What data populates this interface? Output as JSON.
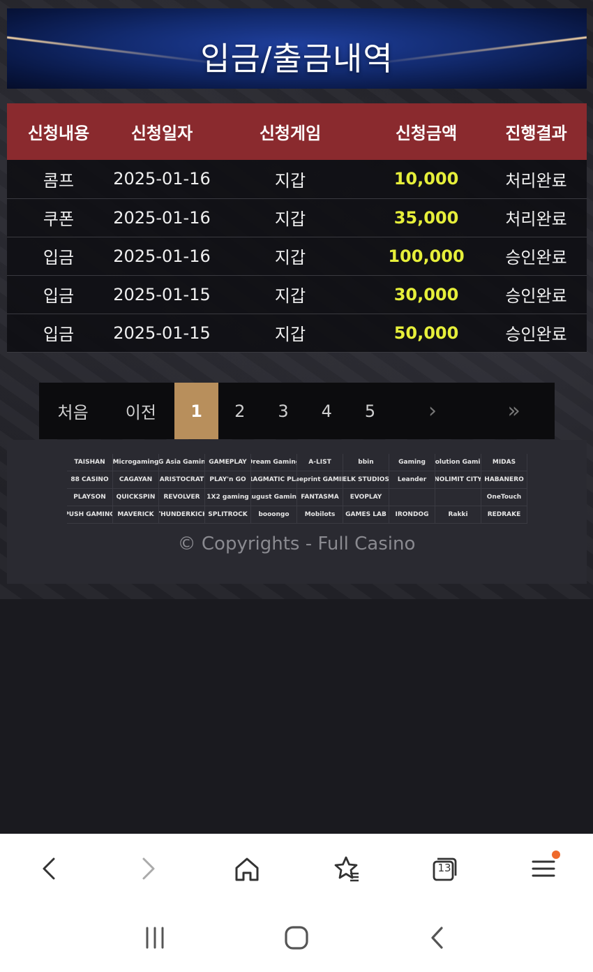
{
  "page": {
    "title": "입금/출금내역"
  },
  "table": {
    "headers": [
      "신청내용",
      "신청일자",
      "신청게임",
      "신청금액",
      "진행결과"
    ],
    "rows": [
      {
        "type": "콤프",
        "date": "2025-01-16",
        "game": "지갑",
        "amount": "10,000",
        "result": "처리완료"
      },
      {
        "type": "쿠폰",
        "date": "2025-01-16",
        "game": "지갑",
        "amount": "35,000",
        "result": "처리완료"
      },
      {
        "type": "입금",
        "date": "2025-01-16",
        "game": "지갑",
        "amount": "100,000",
        "result": "승인완료"
      },
      {
        "type": "입금",
        "date": "2025-01-15",
        "game": "지갑",
        "amount": "30,000",
        "result": "승인완료"
      },
      {
        "type": "입금",
        "date": "2025-01-15",
        "game": "지갑",
        "amount": "50,000",
        "result": "승인완료"
      }
    ],
    "colors": {
      "header_bg": "#8a2a2e",
      "amount": "#e6ef3a"
    }
  },
  "pagination": {
    "first": "처음",
    "prev": "이전",
    "pages": [
      "1",
      "2",
      "3",
      "4",
      "5"
    ],
    "active": "1",
    "next_icon": "chevron-right-icon",
    "last_icon": "double-chevron-right-icon",
    "active_color": "#b88f5c"
  },
  "footer": {
    "providers": [
      "TAISHAN",
      "Microgaming",
      "AG Asia Gaming",
      "GAMEPLAY",
      "Dream Gaming",
      "A-LIST",
      "bbin",
      "Gaming",
      "Evolution Gaming",
      "MIDAS",
      "88 CASINO",
      "CAGAYAN",
      "ARISTOCRAT",
      "PLAY'n GO",
      "PRAGMATIC PLAY",
      "blueprint GAMING",
      "ELK STUDIOS",
      "Leander",
      "NOLIMIT CITY",
      "HABANERO",
      "PLAYSON",
      "QUICKSPIN",
      "REVOLVER",
      "1X2 gaming",
      "August Gaming",
      "FANTASMA",
      "EVOPLAY",
      "",
      "",
      "OneTouch",
      "PUSH GAMING",
      "MAVERICK",
      "THUNDERKICK",
      "SPLITROCK",
      "booongo",
      "Mobilots",
      "GAMES LAB",
      "IRONDOG",
      "Rakki",
      "REDRAKE"
    ],
    "copyright": "© Copyrights - Full Casino"
  },
  "browser": {
    "buttons": [
      "back-icon",
      "forward-icon",
      "home-icon",
      "bookmarks-icon",
      "tabs-icon",
      "menu-icon"
    ],
    "tab_count": "13",
    "notification_color": "#ef6a2c"
  },
  "system_nav": {
    "buttons": [
      "recent-apps-icon",
      "home-icon",
      "back-icon"
    ]
  }
}
